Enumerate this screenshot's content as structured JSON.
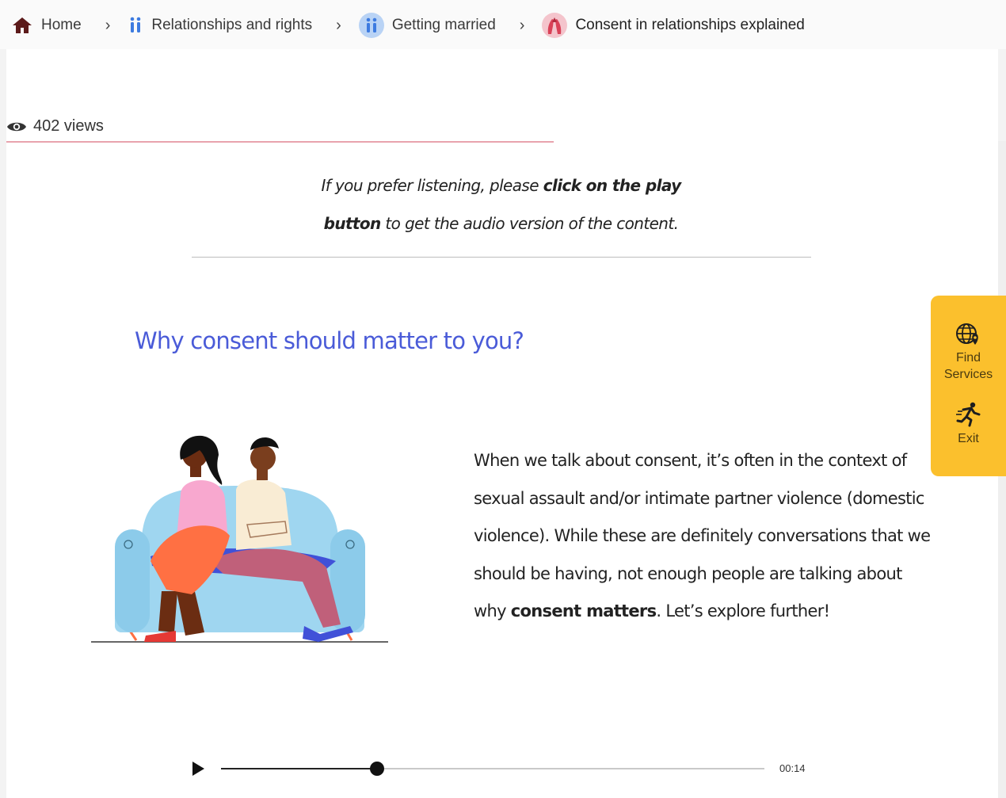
{
  "breadcrumb": {
    "home": "Home",
    "relationships": "Relationships and rights",
    "getting_married": "Getting married",
    "current": "Consent in relationships explained"
  },
  "views": {
    "text": "402 views"
  },
  "intro": {
    "part1": "If you prefer listening, please ",
    "bold1": "click on the play",
    "bold2": "button",
    "part2": " to get the audio version of the content."
  },
  "heading": "Why consent should matter to you?",
  "body": {
    "text1": "When we talk about consent, it’s often in the context of sexual assault and/or intimate partner violence (domestic violence). While these are definitely conversations that we should be having, not enough people are talking about why ",
    "bold": "consent matters",
    "text2": ". Let’s explore further!"
  },
  "side_panel": {
    "find_services": "Find Services",
    "exit": "Exit"
  },
  "audio": {
    "time": "00:14",
    "progress": 0.287
  },
  "colors": {
    "heading": "#4a5bd8",
    "side_panel": "#fbc02d",
    "views_underline": "#e9a3ad",
    "home_icon": "#5c1a1a"
  },
  "icons": [
    "home-icon",
    "chevron-right-icon",
    "people-icon",
    "consent-hands-icon",
    "eye-icon",
    "globe-location-icon",
    "running-person-icon",
    "play-icon"
  ]
}
